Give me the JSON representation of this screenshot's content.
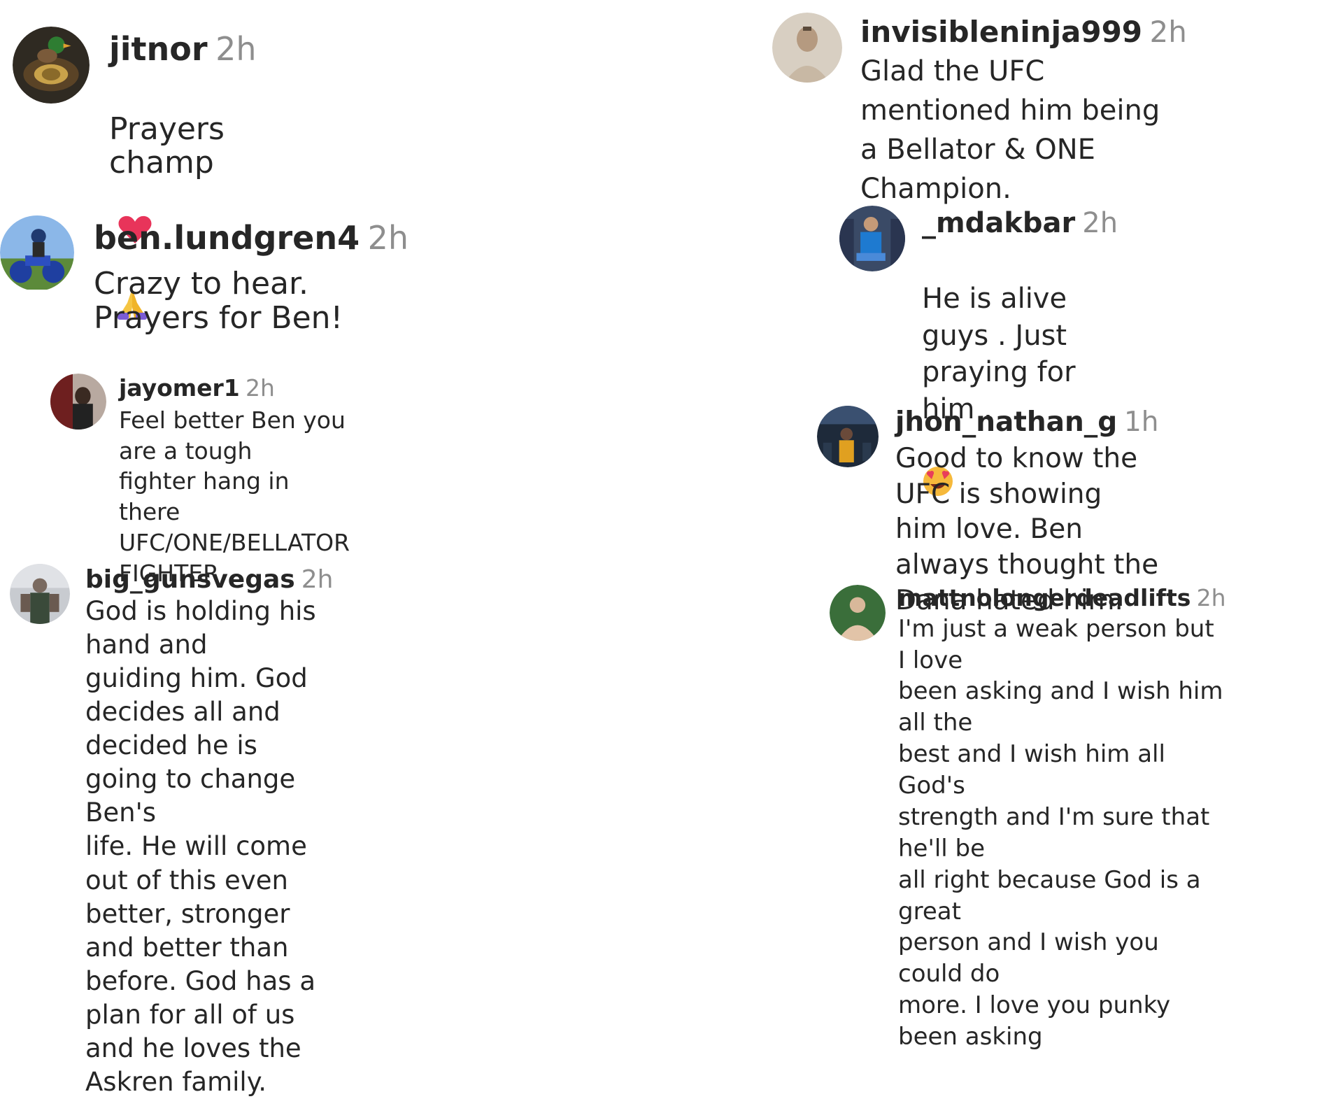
{
  "comments": [
    {
      "username": "jitnor",
      "time": "2h",
      "text": "Prayers champ",
      "emojis": [
        "heart-icon",
        "praying-hands-icon"
      ]
    },
    {
      "username": "ben.lundgren4",
      "time": "2h",
      "text": "Crazy to hear. Prayers for Ben!"
    },
    {
      "username": "jayomer1",
      "time": "2h",
      "text": "Feel better Ben you are a tough\nfighter hang in there\nUFC/ONE/BELLATOR FIGHTER"
    },
    {
      "username": "big_gunsvegas",
      "time": "2h",
      "text": "God is holding his hand and\nguiding him. God decides all and\ndecided he is going to change Ben's\nlife. He will come out of this even\nbetter, stronger and better than\nbefore. God has a plan for all of us\nand he loves the Askren family."
    },
    {
      "username": "invisibleninja999",
      "time": "2h",
      "text": "Glad the UFC mentioned him being\na Bellator & ONE Champion."
    },
    {
      "username": "_mdakbar",
      "time": "2h",
      "text": "He is alive guys . Just praying for\nhim .",
      "emojis": [
        "heart-eyes-icon"
      ]
    },
    {
      "username": "jhon_nathan_g",
      "time": "1h",
      "text": "Good to know the UFC is showing\nhim love. Ben always thought the\nDana hated him."
    },
    {
      "username": "mattnolongerdeadlifts",
      "time": "2h",
      "text": "I'm just a weak person but I love\nbeen asking and I wish him all the\nbest and I wish him all God's\nstrength and I'm sure that he'll be\nall right because God is a great\nperson and I wish you could do\nmore. I love you punky been asking"
    }
  ]
}
